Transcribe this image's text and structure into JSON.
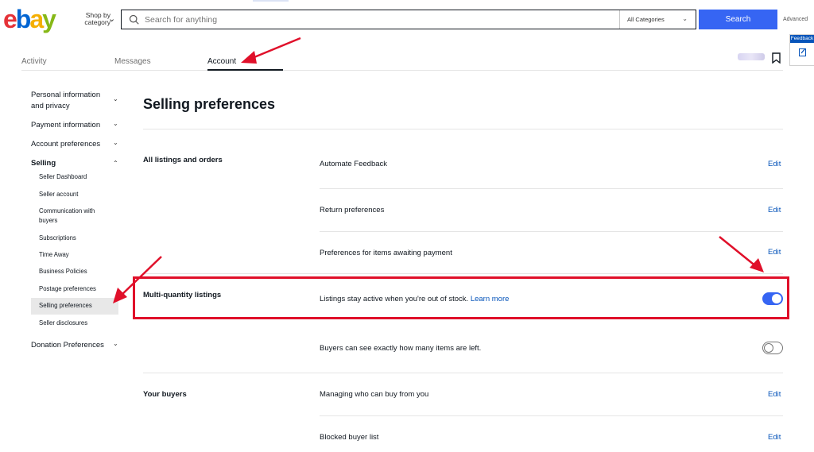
{
  "header": {
    "shop_by": "Shop by category",
    "search_placeholder": "Search for anything",
    "category": "All Categories",
    "search_button": "Search",
    "advanced": "Advanced",
    "feedback": "Feedback"
  },
  "tabs": [
    "Activity",
    "Messages",
    "Account"
  ],
  "sidebar": {
    "sections": [
      {
        "label": "Personal information and privacy"
      },
      {
        "label": "Payment information"
      },
      {
        "label": "Account preferences"
      },
      {
        "label": "Selling"
      },
      {
        "label": "Donation Preferences"
      }
    ],
    "selling_items": [
      "Seller Dashboard",
      "Seller account",
      "Communication with buyers",
      "Subscriptions",
      "Time Away",
      "Business Policies",
      "Postage preferences",
      "Selling preferences",
      "Seller disclosures"
    ]
  },
  "main": {
    "title": "Selling preferences",
    "sections": {
      "all_listings": "All listings and orders",
      "multi_quantity": "Multi-quantity listings",
      "your_buyers": "Your buyers"
    },
    "rows": {
      "automate_feedback": "Automate Feedback",
      "return_preferences": "Return preferences",
      "awaiting_payment": "Preferences for items awaiting payment",
      "stay_active": "Listings stay active when you're out of stock.",
      "learn_more": "Learn more",
      "items_left": "Buyers can see exactly how many items are left.",
      "managing_buyers": "Managing who can buy from you",
      "blocked_buyers": "Blocked buyer list"
    },
    "edit_label": "Edit",
    "toggles": {
      "stay_active": true,
      "items_left": false
    }
  },
  "colors": {
    "accent": "#3665f3",
    "link": "#0654ba",
    "annotation": "#e0102a"
  }
}
